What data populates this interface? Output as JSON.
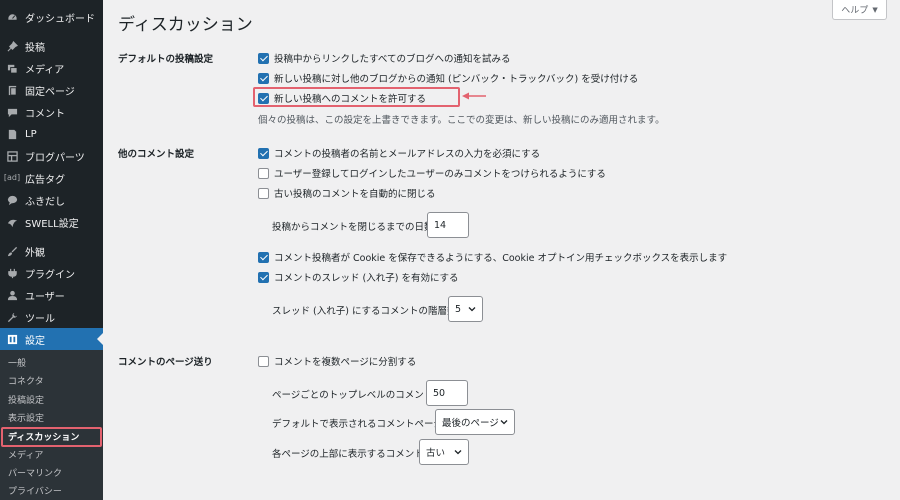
{
  "sidebar": {
    "items": [
      {
        "label": "ダッシュボード",
        "icon": "dashboard-icon"
      },
      {
        "label": "投稿",
        "icon": "pin-icon"
      },
      {
        "label": "メディア",
        "icon": "media-icon"
      },
      {
        "label": "固定ページ",
        "icon": "page-icon"
      },
      {
        "label": "コメント",
        "icon": "comment-icon"
      },
      {
        "label": "LP",
        "icon": "document-icon"
      },
      {
        "label": "ブログパーツ",
        "icon": "grid-icon"
      },
      {
        "label": "広告タグ",
        "icon": "ad-tag-icon",
        "icon_text": "[ad]"
      },
      {
        "label": "ふきだし",
        "icon": "speech-bubble-icon"
      },
      {
        "label": "SWELL設定",
        "icon": "swell-icon"
      },
      {
        "label": "外観",
        "icon": "brush-icon"
      },
      {
        "label": "プラグイン",
        "icon": "plugin-icon"
      },
      {
        "label": "ユーザー",
        "icon": "user-icon"
      },
      {
        "label": "ツール",
        "icon": "wrench-icon"
      },
      {
        "label": "設定",
        "icon": "settings-icon"
      }
    ],
    "submenu": [
      "一般",
      "コネクタ",
      "投稿設定",
      "表示設定",
      "ディスカッション",
      "メディア",
      "パーマリンク",
      "プライバシー"
    ]
  },
  "header": {
    "title": "ディスカッション",
    "help_label": "ヘルプ",
    "help_caret": "▼"
  },
  "sections": {
    "default_post": {
      "label": "デフォルトの投稿設定",
      "options": [
        {
          "label": "投稿中からリンクしたすべてのブログへの通知を試みる",
          "checked": true
        },
        {
          "label": "新しい投稿に対し他のブログからの通知 (ピンバック・トラックバック) を受け付ける",
          "checked": true
        },
        {
          "label": "新しい投稿へのコメントを許可する",
          "checked": true
        }
      ],
      "note": "個々の投稿は、この設定を上書きできます。ここでの変更は、新しい投稿にのみ適用されます。"
    },
    "other_comment": {
      "label": "他のコメント設定",
      "options": [
        {
          "label": "コメントの投稿者の名前とメールアドレスの入力を必須にする",
          "checked": true
        },
        {
          "label": "ユーザー登録してログインしたユーザーのみコメントをつけられるようにする",
          "checked": false
        },
        {
          "label": "古い投稿のコメントを自動的に閉じる",
          "checked": false
        },
        {
          "label": "コメント投稿者が Cookie を保存できるようにする、Cookie オプトイン用チェックボックスを表示します",
          "checked": true
        },
        {
          "label": "コメントのスレッド (入れ子) を有効にする",
          "checked": true
        }
      ],
      "close_days_label": "投稿からコメントを閉じるまでの日数",
      "close_days_value": "14",
      "thread_depth_label": "スレッド (入れ子) にするコメントの階層数",
      "thread_depth_value": "5"
    },
    "paging": {
      "label": "コメントのページ送り",
      "option": {
        "label": "コメントを複数ページに分割する",
        "checked": false
      },
      "per_page_label": "ページごとのトップレベルのコメント",
      "per_page_value": "50",
      "default_page_label": "デフォルトで表示されるコメントページ",
      "default_page_value": "最後のページ",
      "order_label": "各ページの上部に表示するコメント",
      "order_value": "古い"
    }
  },
  "colors": {
    "sidebar_bg": "#1d2327",
    "active_bg": "#2271b1",
    "highlight": "#e3626f",
    "checkbox": "#2271b1"
  }
}
